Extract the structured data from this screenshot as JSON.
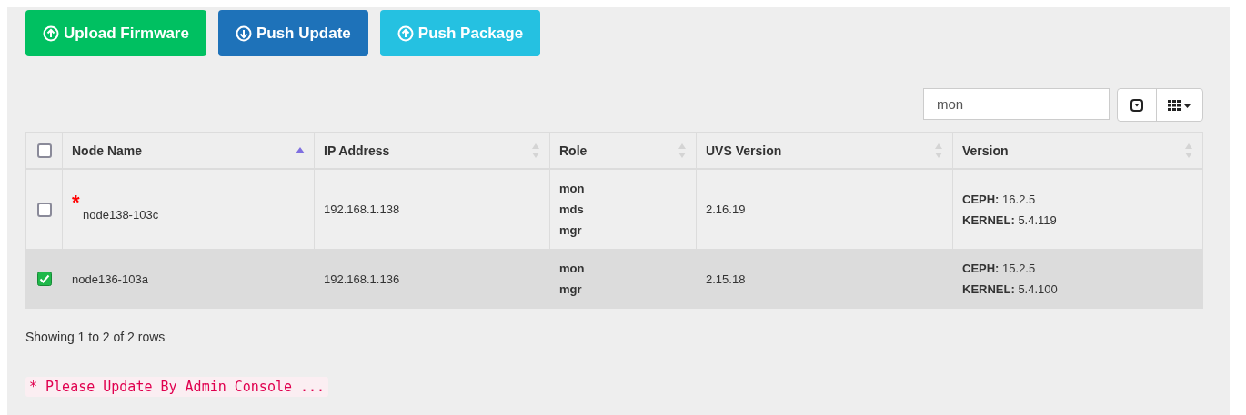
{
  "toolbar": {
    "buttons": [
      {
        "label": "Upload Firmware",
        "kind": "upload"
      },
      {
        "label": "Push Update",
        "kind": "download"
      },
      {
        "label": "Push Package",
        "kind": "upload"
      }
    ]
  },
  "search": {
    "value": "mon"
  },
  "table": {
    "select_all": {
      "checked": false
    },
    "columns": [
      {
        "label": "Node Name",
        "sorted": true
      },
      {
        "label": "IP Address",
        "sorted": false
      },
      {
        "label": "Role",
        "sorted": false
      },
      {
        "label": "UVS Version",
        "sorted": false
      },
      {
        "label": "Version",
        "sorted": false
      }
    ],
    "rows": [
      {
        "checked": false,
        "marker": "*",
        "node_name": "node138-103c",
        "ip": "192.168.1.138",
        "roles": [
          "mon",
          "mds",
          "mgr"
        ],
        "uvs_version": "2.16.19",
        "version": [
          "**CEPH:** 16.2.5",
          "**KERNEL:** 5.4.119"
        ]
      },
      {
        "checked": true,
        "node_name": "node136-103a",
        "ip": "192.168.1.136",
        "roles": [
          "mon",
          "mgr"
        ],
        "uvs_version": "2.15.18",
        "version": [
          "**CEPH:** 15.2.5",
          "**KERNEL:** 5.4.100"
        ]
      }
    ]
  },
  "pagination_info": "Showing 1 to 2 of 2 rows",
  "note": "* Please Update By Admin Console ..."
}
